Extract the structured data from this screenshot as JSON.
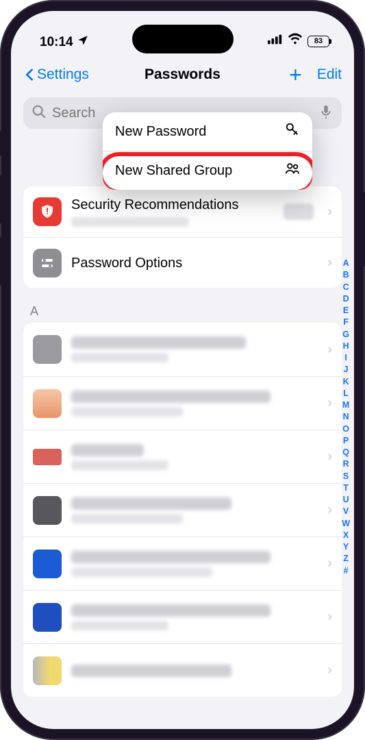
{
  "status": {
    "time": "10:14",
    "battery_pct": "83"
  },
  "nav": {
    "back_label": "Settings",
    "title": "Passwords",
    "edit_label": "Edit"
  },
  "search": {
    "placeholder": "Search"
  },
  "menu": {
    "new_password": "New Password",
    "new_shared_group": "New Shared Group"
  },
  "sections": {
    "security": {
      "title": "Security Recommendations"
    },
    "options": {
      "title": "Password Options"
    },
    "letter_a": "A"
  },
  "index_letters": [
    "A",
    "B",
    "C",
    "D",
    "E",
    "F",
    "G",
    "H",
    "I",
    "J",
    "K",
    "L",
    "M",
    "N",
    "O",
    "P",
    "Q",
    "R",
    "S",
    "T",
    "U",
    "V",
    "W",
    "X",
    "Y",
    "Z",
    "#"
  ]
}
